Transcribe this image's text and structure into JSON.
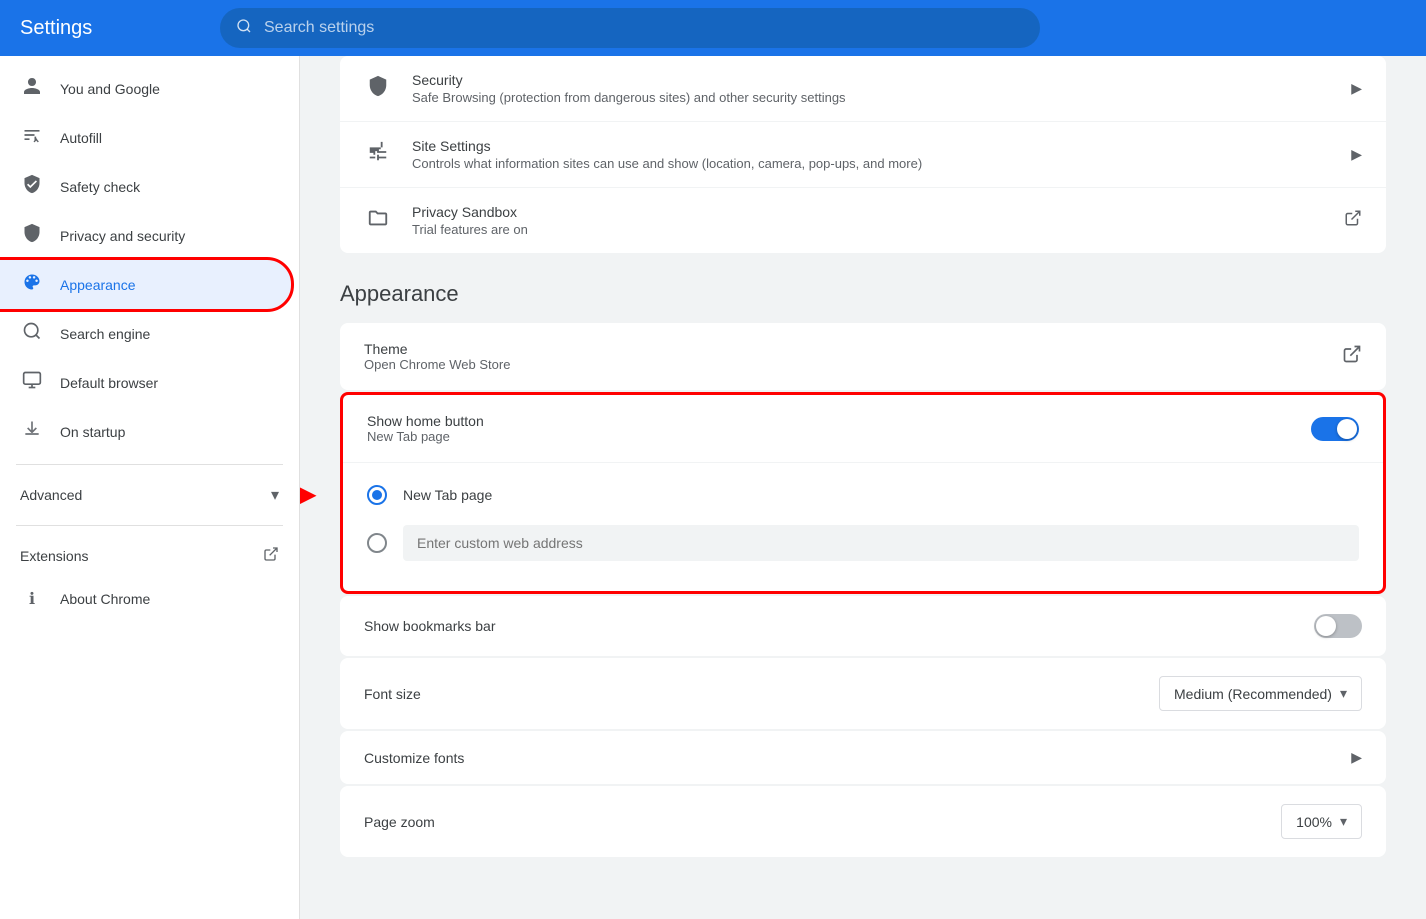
{
  "header": {
    "title": "Settings",
    "search_placeholder": "Search settings"
  },
  "sidebar": {
    "items": [
      {
        "id": "you-and-google",
        "label": "You and Google",
        "icon": "👤"
      },
      {
        "id": "autofill",
        "label": "Autofill",
        "icon": "📋"
      },
      {
        "id": "safety-check",
        "label": "Safety check",
        "icon": "🛡"
      },
      {
        "id": "privacy-and-security",
        "label": "Privacy and security",
        "icon": "🛡"
      },
      {
        "id": "appearance",
        "label": "Appearance",
        "icon": "🎨",
        "active": true
      },
      {
        "id": "search-engine",
        "label": "Search engine",
        "icon": "🔍"
      },
      {
        "id": "default-browser",
        "label": "Default browser",
        "icon": "🖥"
      },
      {
        "id": "on-startup",
        "label": "On startup",
        "icon": "⏻"
      }
    ],
    "advanced_label": "Advanced",
    "extensions_label": "Extensions",
    "about_chrome_label": "About Chrome"
  },
  "privacy_section": {
    "items": [
      {
        "id": "security",
        "label": "Security",
        "subtitle": "Safe Browsing (protection from dangerous sites) and other security settings",
        "icon": "🛡"
      },
      {
        "id": "site-settings",
        "label": "Site Settings",
        "subtitle": "Controls what information sites can use and show (location, camera, pop-ups, and more)",
        "icon": "⚙"
      },
      {
        "id": "privacy-sandbox",
        "label": "Privacy Sandbox",
        "subtitle": "Trial features are on",
        "icon": "🧪"
      }
    ]
  },
  "appearance_section": {
    "header": "Appearance",
    "theme": {
      "label": "Theme",
      "sublabel": "Open Chrome Web Store"
    },
    "show_home_button": {
      "label": "Show home button",
      "sublabel": "New Tab page",
      "toggle_on": true,
      "radio_options": [
        {
          "id": "new-tab",
          "label": "New Tab page",
          "selected": true
        },
        {
          "id": "custom-url",
          "label": "",
          "placeholder": "Enter custom web address",
          "selected": false
        }
      ]
    },
    "show_bookmarks_bar": {
      "label": "Show bookmarks bar",
      "toggle_on": false
    },
    "font_size": {
      "label": "Font size",
      "value": "Medium (Recommended)"
    },
    "customize_fonts": {
      "label": "Customize fonts"
    },
    "page_zoom": {
      "label": "Page zoom",
      "value": "100%"
    }
  }
}
